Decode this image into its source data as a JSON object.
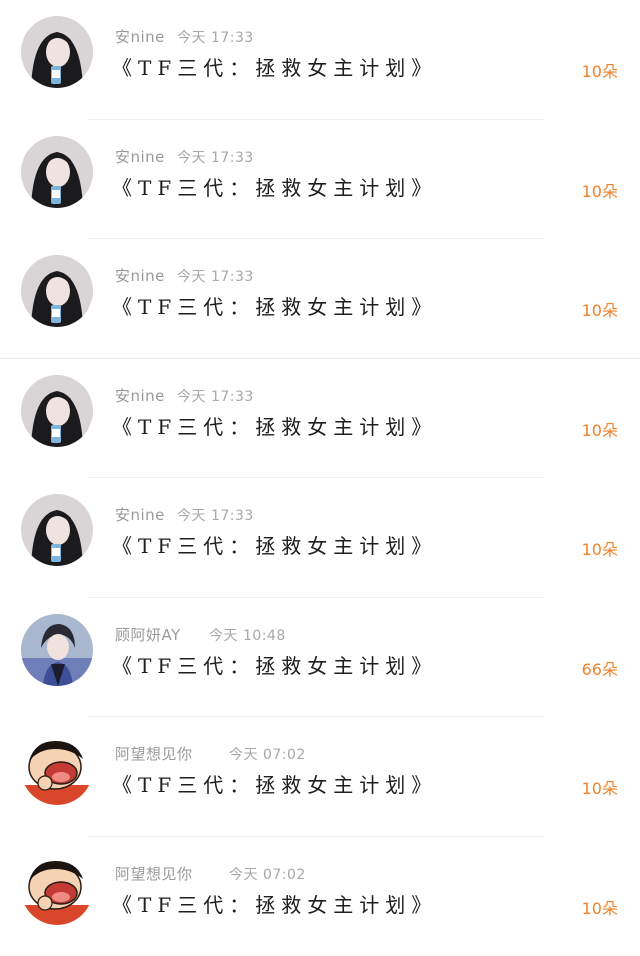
{
  "colors": {
    "gift": "#f0832a",
    "name": "#9a9a9a",
    "title": "#1e1e1e",
    "divider": "#f0f0f0"
  },
  "messages": [
    {
      "avatar_icon": "girl-avatar-icon",
      "name": "安nine",
      "time": "今天 17:33",
      "title": "《TF三代：拯救女主计划》",
      "gift": "10朵"
    },
    {
      "avatar_icon": "girl-avatar-icon",
      "name": "安nine",
      "time": "今天 17:33",
      "title": "《TF三代：拯救女主计划》",
      "gift": "10朵"
    },
    {
      "avatar_icon": "girl-avatar-icon",
      "name": "安nine",
      "time": "今天 17:33",
      "title": "《TF三代：拯救女主计划》",
      "gift": "10朵"
    },
    {
      "avatar_icon": "girl-avatar-icon",
      "name": "安nine",
      "time": "今天 17:33",
      "title": "《TF三代：拯救女主计划》",
      "gift": "10朵"
    },
    {
      "avatar_icon": "girl-avatar-icon",
      "name": "安nine",
      "time": "今天 17:33",
      "title": "《TF三代：拯救女主计划》",
      "gift": "10朵"
    },
    {
      "avatar_icon": "boy-avatar-icon",
      "name": "顾阿妍AY",
      "time": "今天 10:48",
      "title": "《TF三代：拯救女主计划》",
      "gift": "66朵"
    },
    {
      "avatar_icon": "cartoon-avatar-icon",
      "name": "阿望想见你",
      "time": "今天 07:02",
      "title": "《TF三代：拯救女主计划》",
      "gift": "10朵"
    },
    {
      "avatar_icon": "cartoon-avatar-icon",
      "name": "阿望想见你",
      "time": "今天 07:02",
      "title": "《TF三代：拯救女主计划》",
      "gift": "10朵"
    }
  ]
}
